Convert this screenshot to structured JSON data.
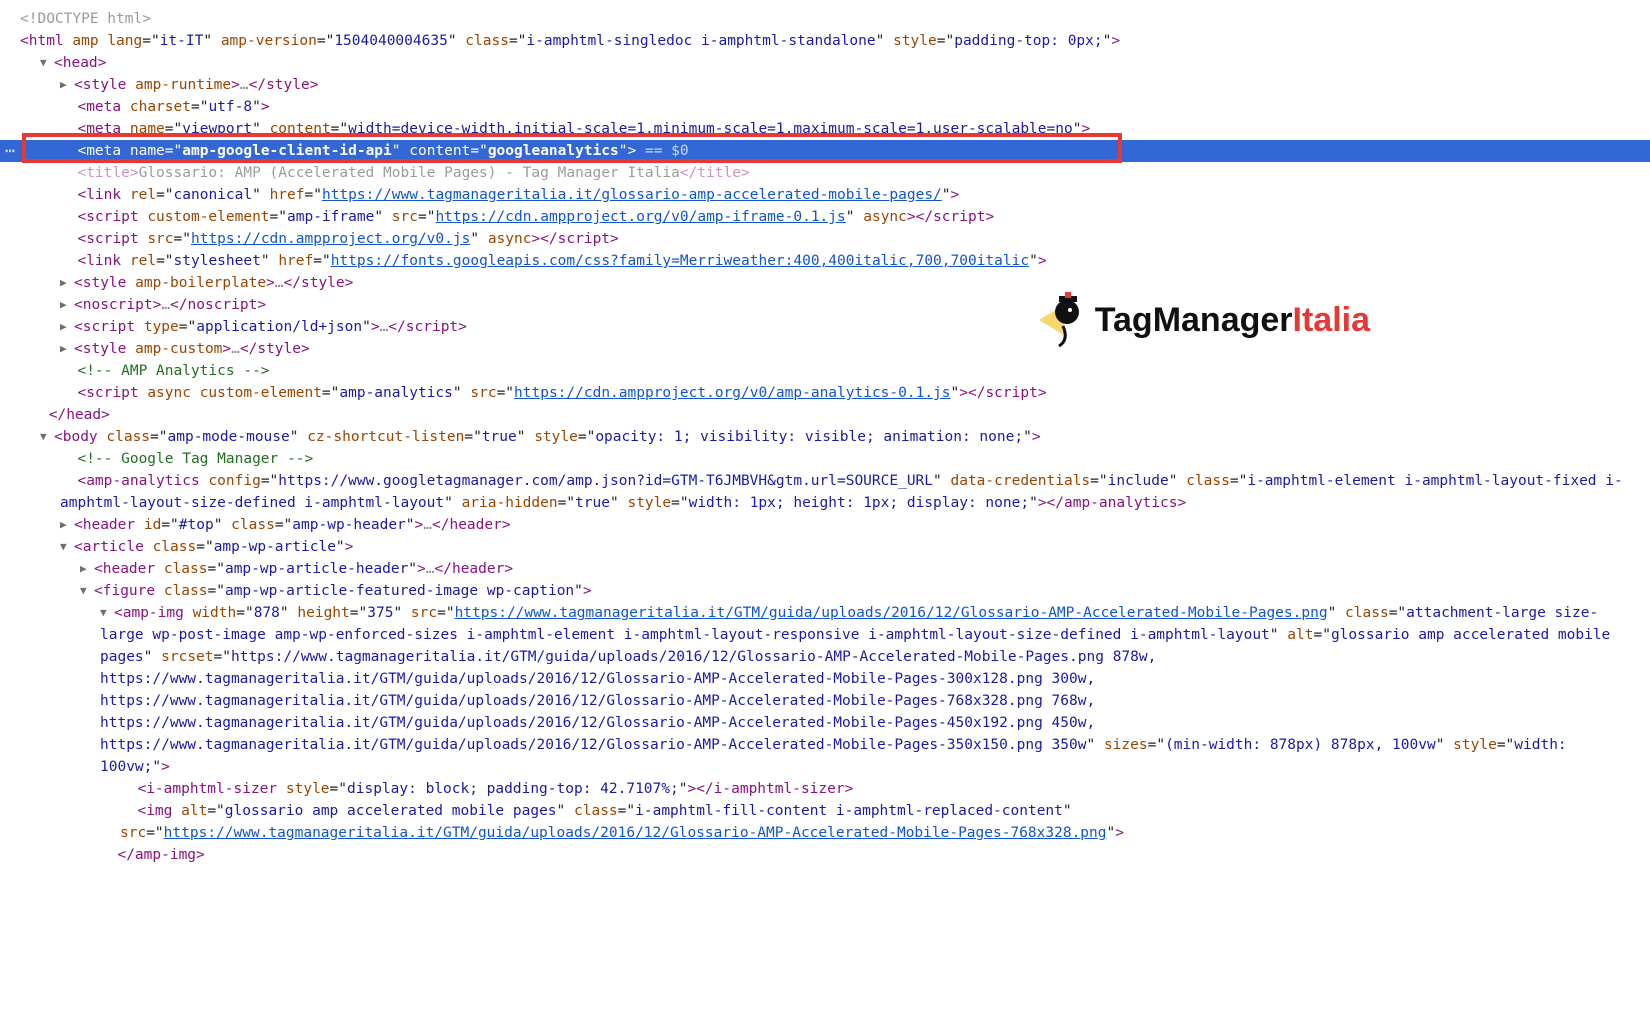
{
  "lines": {
    "doctype": "<!DOCTYPE html>",
    "html_open": {
      "lang": "it-IT",
      "amp_version": "1504040004635",
      "class": "i-amphtml-singledoc i-amphtml-standalone",
      "style": "padding-top: 0px;"
    },
    "head_open": "head",
    "style_amp_runtime": "amp-runtime",
    "meta_charset": "utf-8",
    "meta_viewport": {
      "name": "viewport",
      "content": "width=device-width,initial-scale=1,minimum-scale=1,maximum-scale=1,user-scalable=no"
    },
    "meta_selected": {
      "name": "amp-google-client-id-api",
      "content": "googleanalytics",
      "eq": "== $0"
    },
    "title_text": "Glossario: AMP (Accelerated Mobile Pages) - Tag Manager Italia",
    "link_canonical": {
      "rel": "canonical",
      "href": "https://www.tagmanageritalia.it/glossario-amp-accelerated-mobile-pages/"
    },
    "script_amp_iframe": {
      "custom_element": "amp-iframe",
      "src": "https://cdn.ampproject.org/v0/amp-iframe-0.1.js",
      "async": "async"
    },
    "script_v0": {
      "src": "https://cdn.ampproject.org/v0.js",
      "async": "async"
    },
    "link_fonts": {
      "rel": "stylesheet",
      "href": "https://fonts.googleapis.com/css?family=Merriweather:400,400italic,700,700italic"
    },
    "style_boilerplate": "amp-boilerplate",
    "noscript": "noscript",
    "script_ldjson": {
      "type": "application/ld+json"
    },
    "style_custom": "amp-custom",
    "comment_analytics": "<!-- AMP Analytics -->",
    "script_amp_analytics": {
      "custom_element": "amp-analytics",
      "src": "https://cdn.ampproject.org/v0/amp-analytics-0.1.js"
    },
    "head_close": "head",
    "body_open": {
      "class": "amp-mode-mouse",
      "cz": "true",
      "style": "opacity: 1; visibility: visible; animation: none;"
    },
    "comment_gtm": "<!-- Google Tag Manager -->",
    "amp_analytics": {
      "config": "https://www.googletagmanager.com/amp.json?id=GTM-T6JMBVH&gtm.url=SOURCE_URL",
      "data_credentials": "include",
      "class": "i-amphtml-element i-amphtml-layout-fixed i-amphtml-layout-size-defined i-amphtml-layout",
      "aria_hidden": "true",
      "style": "width: 1px; height: 1px; display: none;"
    },
    "header": {
      "id": "#top",
      "class": "amp-wp-header"
    },
    "article": {
      "class": "amp-wp-article"
    },
    "article_header": {
      "class": "amp-wp-article-header"
    },
    "figure": {
      "class": "amp-wp-article-featured-image wp-caption"
    },
    "amp_img": {
      "width": "878",
      "height": "375",
      "src": "https://www.tagmanageritalia.it/GTM/guida/uploads/2016/12/Glossario-AMP-Accelerated-Mobile-Pages.png",
      "class": "attachment-large size-large wp-post-image amp-wp-enforced-sizes i-amphtml-element i-amphtml-layout-responsive i-amphtml-layout-size-defined i-amphtml-layout",
      "alt": "glossario amp accelerated mobile pages",
      "srcset": "https://www.tagmanageritalia.it/GTM/guida/uploads/2016/12/Glossario-AMP-Accelerated-Mobile-Pages.png 878w, https://www.tagmanageritalia.it/GTM/guida/uploads/2016/12/Glossario-AMP-Accelerated-Mobile-Pages-300x128.png 300w, https://www.tagmanageritalia.it/GTM/guida/uploads/2016/12/Glossario-AMP-Accelerated-Mobile-Pages-768x328.png 768w, https://www.tagmanageritalia.it/GTM/guida/uploads/2016/12/Glossario-AMP-Accelerated-Mobile-Pages-450x192.png 450w, https://www.tagmanageritalia.it/GTM/guida/uploads/2016/12/Glossario-AMP-Accelerated-Mobile-Pages-350x150.png 350w",
      "sizes": "(min-width: 878px) 878px, 100vw",
      "style": "width: 100vw;"
    },
    "sizer": {
      "style": "display: block; padding-top: 42.7107%;"
    },
    "img": {
      "alt": "glossario amp accelerated mobile pages",
      "class": "i-amphtml-fill-content i-amphtml-replaced-content",
      "src": "https://www.tagmanageritalia.it/GTM/guida/uploads/2016/12/Glossario-AMP-Accelerated-Mobile-Pages-768x328.png"
    },
    "amp_img_close": "amp-img"
  },
  "logo": {
    "main": "TagManager",
    "accent": "Italia"
  }
}
